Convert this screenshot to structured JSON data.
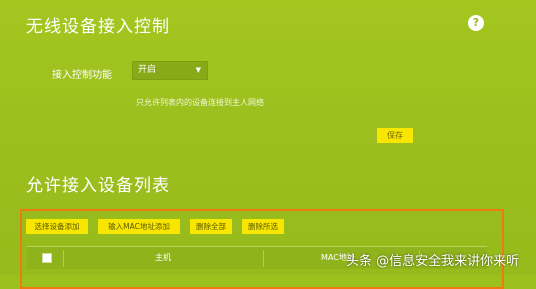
{
  "section1": {
    "title": "无线设备接入控制",
    "help_icon": "help-icon",
    "help_glyph": "?"
  },
  "access_control": {
    "label": "接入控制功能",
    "select_value": "开启",
    "hint": "只允许列表内的设备连接到主人网络",
    "save_label": "保存"
  },
  "section2": {
    "title": "允许接入设备列表"
  },
  "toolbar": {
    "select_add": "选择设备添加",
    "mac_add": "输入MAC地址添加",
    "delete_all": "删除全部",
    "delete_selected": "删除所选"
  },
  "table": {
    "columns": [
      "主机",
      "MAC地址"
    ]
  },
  "watermark": "头条 @信息安全我来讲你来听",
  "colors": {
    "background": "#9cc01e",
    "button": "#f9e600",
    "highlight_border": "#f07a12"
  }
}
